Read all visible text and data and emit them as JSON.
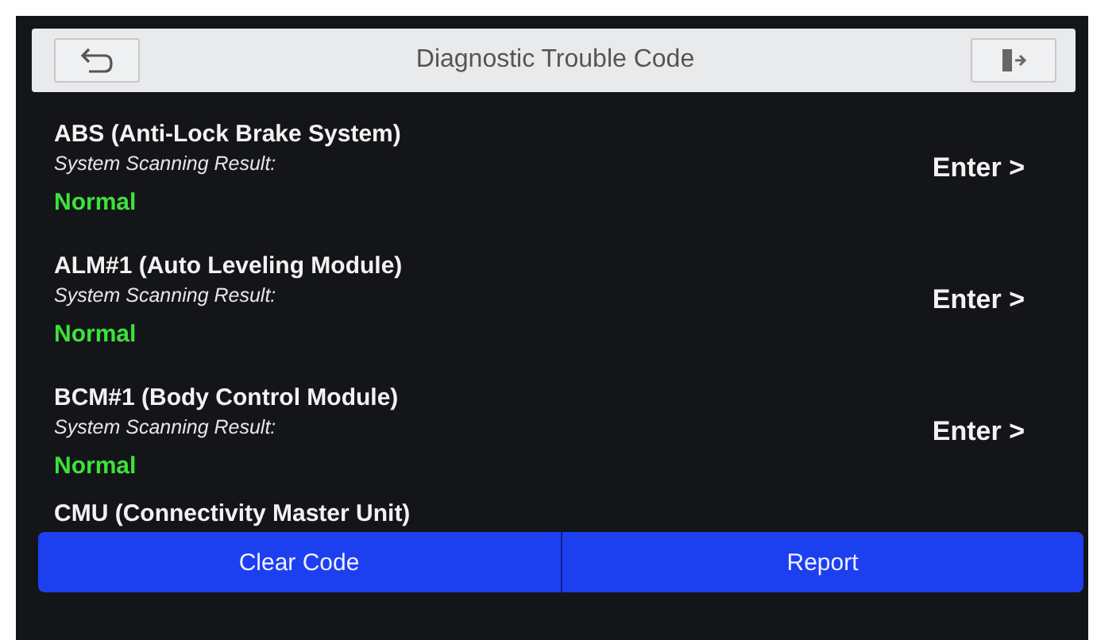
{
  "header": {
    "title": "Diagnostic Trouble Code"
  },
  "systems": [
    {
      "name": "ABS (Anti-Lock Brake System)",
      "label": "System Scanning Result:",
      "result": "Normal",
      "action": "Enter >"
    },
    {
      "name": "ALM#1 (Auto Leveling Module)",
      "label": "System Scanning Result:",
      "result": "Normal",
      "action": "Enter >"
    },
    {
      "name": "BCM#1 (Body Control Module)",
      "label": "System Scanning Result:",
      "result": "Normal",
      "action": "Enter >"
    },
    {
      "name": "CMU (Connectivity Master Unit)"
    }
  ],
  "buttons": [
    "Clear Code",
    "Report"
  ]
}
